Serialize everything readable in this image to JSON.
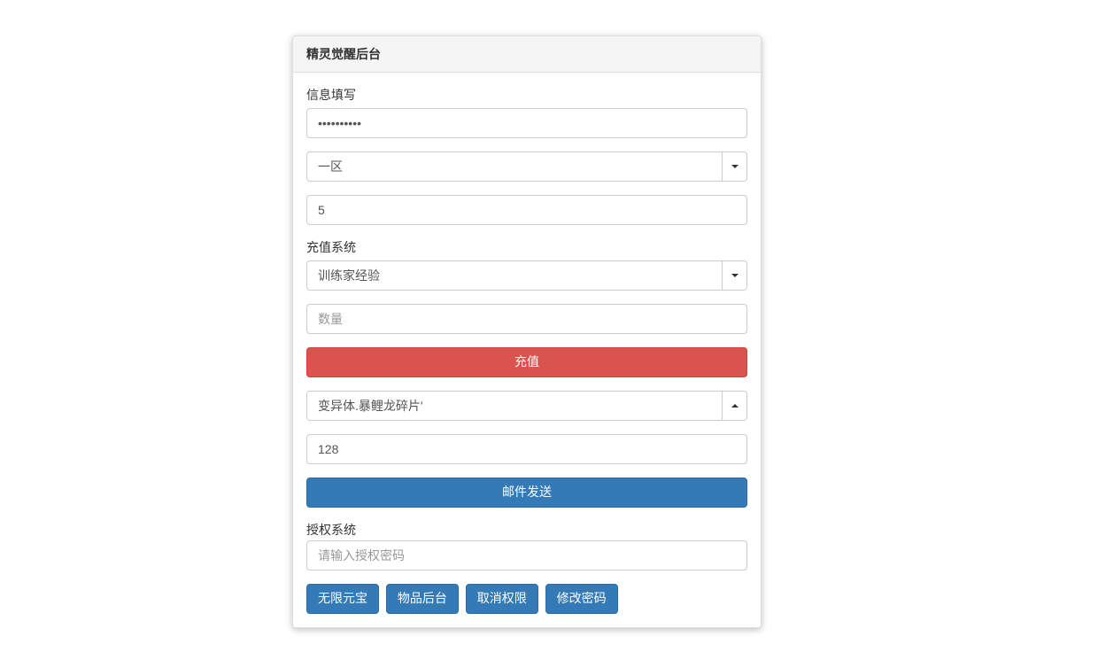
{
  "panel": {
    "title": "精灵觉醒后台"
  },
  "info": {
    "label": "信息填写",
    "password_value": "••••••••••",
    "zone_value": "一区",
    "num_value": "5"
  },
  "recharge": {
    "label": "充值系统",
    "type_value": "训练家经验",
    "qty_placeholder": "数量",
    "button": "充值",
    "item_value": "变异体.暴鲤龙碎片'",
    "item_qty_value": "128",
    "mail_button": "邮件发送"
  },
  "auth": {
    "label": "授权系统",
    "pwd_placeholder": "请输入授权密码"
  },
  "buttons": {
    "unlimited": "无限元宝",
    "items": "物品后台",
    "revoke": "取消权限",
    "changepwd": "修改密码"
  }
}
